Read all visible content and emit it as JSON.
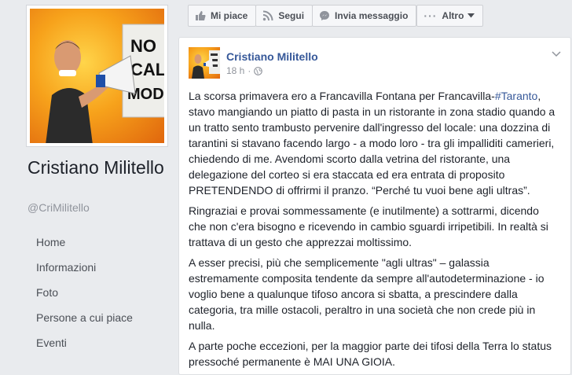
{
  "profile": {
    "name": "Cristiano Militello",
    "handle": "@CriMilitello",
    "sign_text": [
      "NO",
      "CAL",
      "MODE"
    ]
  },
  "nav": {
    "items": [
      {
        "label": "Home"
      },
      {
        "label": "Informazioni"
      },
      {
        "label": "Foto"
      },
      {
        "label": "Persone a cui piace"
      },
      {
        "label": "Eventi"
      }
    ]
  },
  "actionbar": {
    "like": "Mi piace",
    "follow": "Segui",
    "message": "Invia messaggio",
    "more": "Altro"
  },
  "post": {
    "author": "Cristiano Militello",
    "time": "18 h",
    "paragraphs": [
      {
        "before_tag": "La scorsa primavera ero a Francavilla Fontana per Francavilla-",
        "hashtag": "#Taranto",
        "after_tag": ", stavo mangiando un piatto di pasta in un ristorante in zona stadio quando a un tratto sento trambusto pervenire dall'ingresso del locale: una dozzina di tarantini si stavano facendo largo - a modo loro - tra gli impalliditi camerieri, chiedendo di me. Avendomi scorto dalla vetrina del ristorante, una delegazione del corteo si era staccata ed era entrata di proposito PRETENDENDO di offrirmi il pranzo. “Perché tu vuoi bene agli ultras”."
      },
      {
        "text": "Ringraziai e provai sommessamente (e inutilmente) a sottrarmi, dicendo che non c'era bisogno e ricevendo in cambio sguardi irripetibili. In realtà si trattava di un gesto che apprezzai moltissimo."
      },
      {
        "text": "A esser precisi, più che semplicemente \"agli ultras\" – galassia estremamente composita tendente da sempre all'autodeterminazione - io voglio bene a qualunque tifoso ancora si sbatta, a prescindere dalla categoria, tra mille ostacoli, peraltro in una società che non crede più in nulla."
      },
      {
        "text": "A parte poche eccezioni, per la maggior parte dei tifosi della Terra lo status pressoché permanente è MAI UNA GIOIA."
      }
    ]
  }
}
